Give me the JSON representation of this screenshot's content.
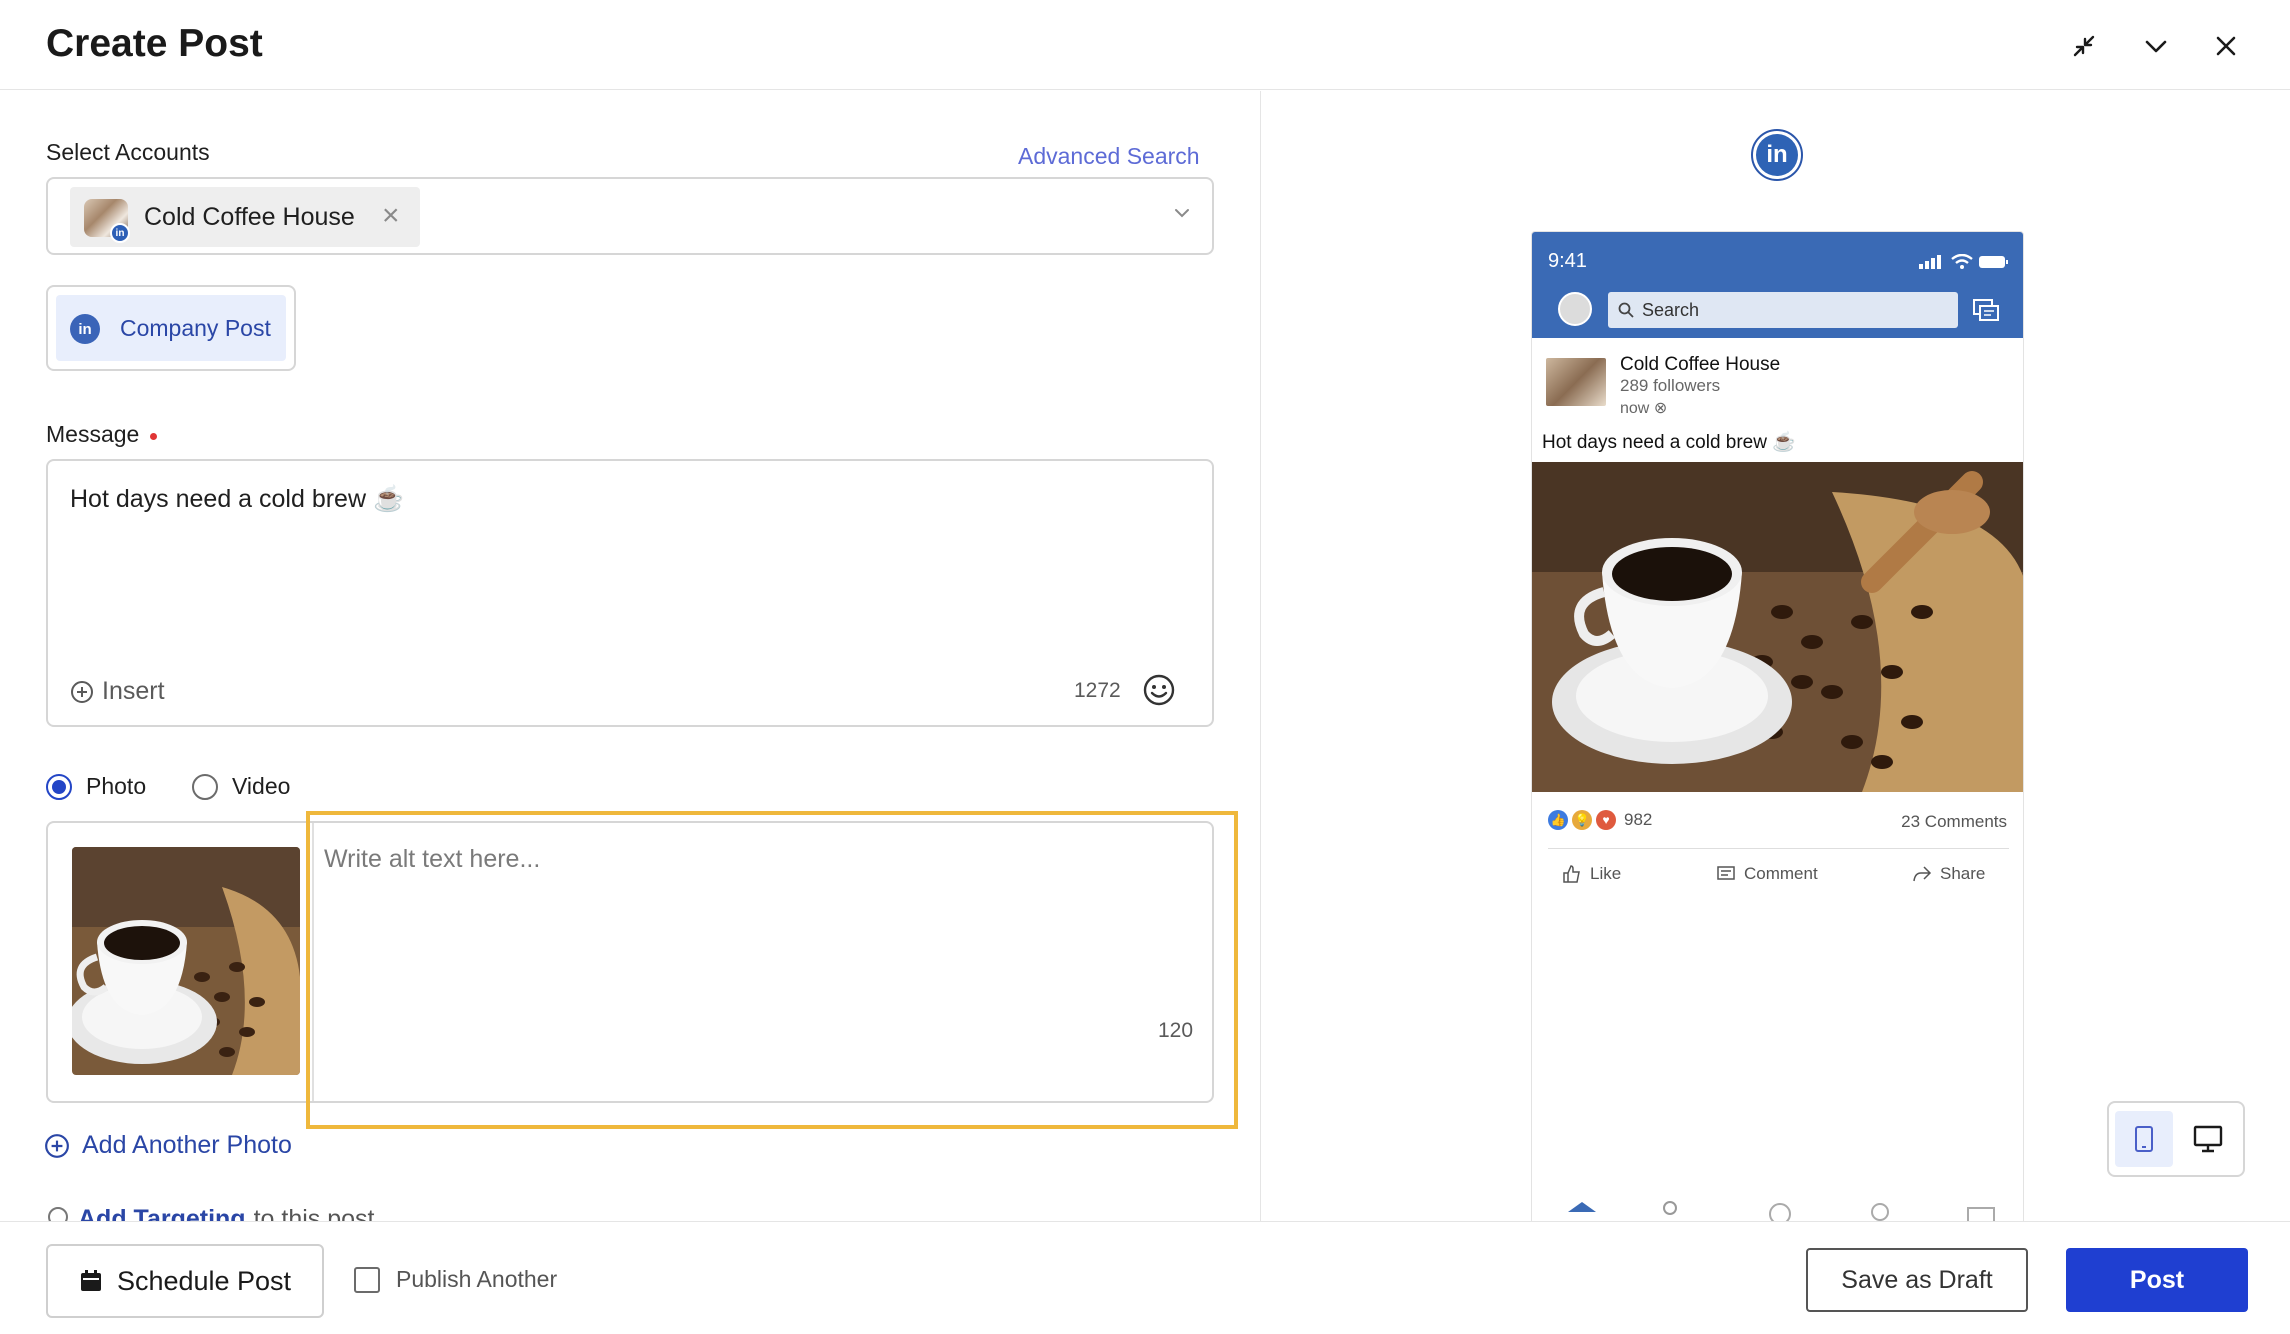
{
  "header": {
    "title": "Create Post"
  },
  "accounts": {
    "label": "Select Accounts",
    "advanced_search": "Advanced Search",
    "selected": [
      {
        "name": "Cold Coffee House",
        "network": "linkedin"
      }
    ],
    "post_type": "Company Post"
  },
  "message": {
    "label": "Message",
    "text": "Hot days need a cold brew ☕",
    "insert_label": "Insert",
    "remaining": "1272"
  },
  "media": {
    "options": [
      {
        "label": "Photo",
        "checked": true
      },
      {
        "label": "Video",
        "checked": false
      }
    ],
    "alt_placeholder": "Write alt text here...",
    "alt_remaining": "120",
    "add_photo": "Add Another Photo",
    "targeting_link": "Add Targeting",
    "targeting_rest": "to this post"
  },
  "preview": {
    "network": "linkedin",
    "phone_time": "9:41",
    "search_placeholder": "Search",
    "account_name": "Cold Coffee House",
    "followers": "289 followers",
    "time": "now",
    "text": "Hot days need a cold brew ☕",
    "reaction_count": "982",
    "comments": "23 Comments",
    "actions": [
      "Like",
      "Comment",
      "Share"
    ],
    "view_modes": [
      "mobile",
      "desktop"
    ],
    "active_view": "mobile"
  },
  "footer": {
    "schedule": "Schedule Post",
    "publish_another": "Publish Another",
    "save_draft": "Save as Draft",
    "post": "Post"
  },
  "colors": {
    "primary": "#1f3fd1",
    "link": "#2a46a6",
    "linkedin": "#3a6ab5",
    "highlight": "#efb83c",
    "required": "#e03535"
  }
}
